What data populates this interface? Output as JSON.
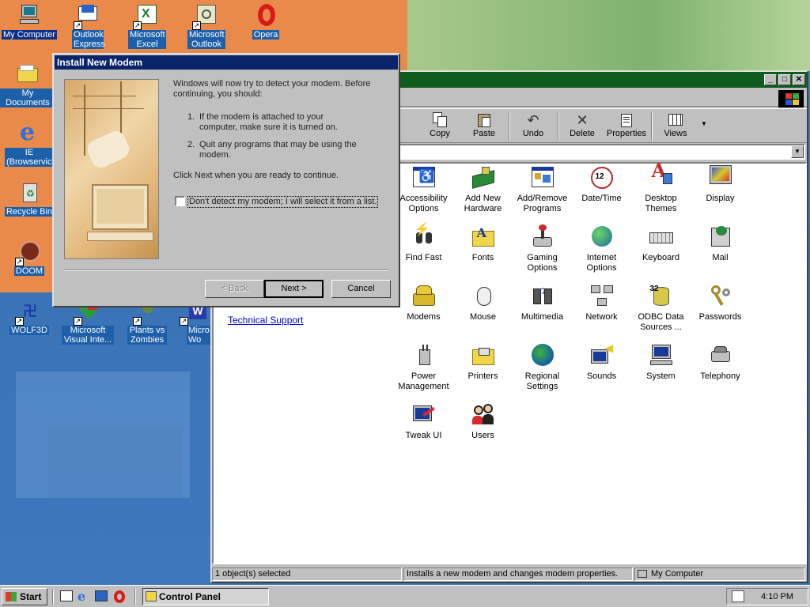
{
  "desktop": {
    "icons": [
      {
        "label": "My Computer"
      },
      {
        "label": "Outlook Express"
      },
      {
        "label": "Microsoft Excel"
      },
      {
        "label": "Microsoft Outlook"
      },
      {
        "label": "Opera"
      },
      {
        "label": "My Documents"
      },
      {
        "label": "IE (Browservice)"
      },
      {
        "label": "Recycle Bin"
      },
      {
        "label": "DOOM"
      },
      {
        "label": "WOLF3D"
      },
      {
        "label": "Microsoft Visual Inte..."
      },
      {
        "label": "Plants vs Zombies"
      },
      {
        "label": "Micro Wo"
      }
    ]
  },
  "control_panel": {
    "title": "Control Panel",
    "toolbar": {
      "copy": "Copy",
      "paste": "Paste",
      "undo": "Undo",
      "delete": "Delete",
      "properties": "Properties",
      "views": "Views"
    },
    "support_link": "Technical Support",
    "items": [
      {
        "label": "Accessibility Options"
      },
      {
        "label": "Add New Hardware"
      },
      {
        "label": "Add/Remove Programs"
      },
      {
        "label": "Date/Time"
      },
      {
        "label": "Desktop Themes"
      },
      {
        "label": "Display"
      },
      {
        "label": "Find Fast"
      },
      {
        "label": "Fonts"
      },
      {
        "label": "Gaming Options"
      },
      {
        "label": "Internet Options"
      },
      {
        "label": "Keyboard"
      },
      {
        "label": "Mail"
      },
      {
        "label": "Modems"
      },
      {
        "label": "Mouse"
      },
      {
        "label": "Multimedia"
      },
      {
        "label": "Network"
      },
      {
        "label": "ODBC Data Sources ..."
      },
      {
        "label": "Passwords"
      },
      {
        "label": "Power Management"
      },
      {
        "label": "Printers"
      },
      {
        "label": "Regional Settings"
      },
      {
        "label": "Sounds"
      },
      {
        "label": "System"
      },
      {
        "label": "Telephony"
      },
      {
        "label": "Tweak UI"
      },
      {
        "label": "Users"
      }
    ],
    "status": {
      "selection": "1 object(s) selected",
      "description": "Installs a new modem and changes modem properties.",
      "location": "My Computer"
    }
  },
  "dialog": {
    "title": "Install New Modem",
    "intro": "Windows will now try to detect your modem.  Before continuing, you should:",
    "step1_num": "1.",
    "step1": "If the modem is attached to your computer, make sure it is turned on.",
    "step2_num": "2.",
    "step2": "Quit any programs that may be using the modem.",
    "next_hint": "Click Next when you are ready to continue.",
    "checkbox_label": "Don't detect my modem; I will select it from a list.",
    "back_label": "< Back",
    "next_label": "Next >",
    "cancel_label": "Cancel"
  },
  "taskbar": {
    "start_label": "Start",
    "task_label": "Control Panel",
    "clock": "4:10 PM"
  }
}
